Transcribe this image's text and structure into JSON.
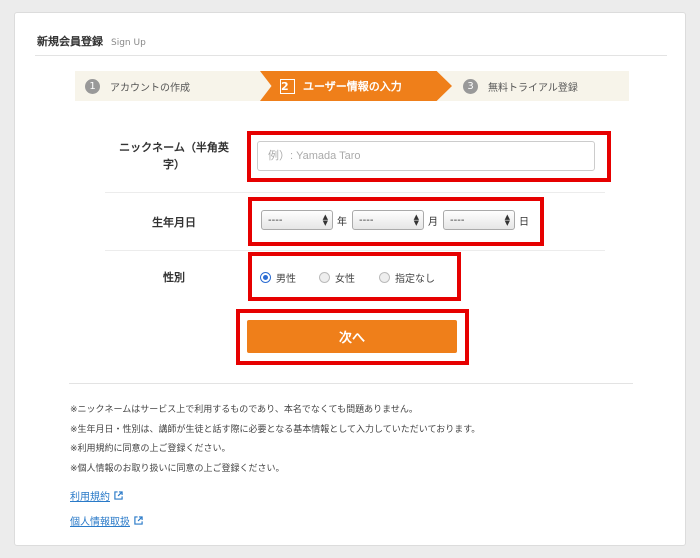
{
  "header": {
    "title": "新規会員登録",
    "subtitle": "Sign Up"
  },
  "steps": [
    {
      "num": "1",
      "label": "アカウントの作成"
    },
    {
      "num": "2",
      "label": "ユーザー情報の入力"
    },
    {
      "num": "3",
      "label": "無料トライアル登録"
    }
  ],
  "form": {
    "nickname_label_line1": "ニックネーム（半角英",
    "nickname_label_line2": "字）",
    "nickname_placeholder": "例）: Yamada Taro",
    "birth_label": "生年月日",
    "year_value": "----",
    "month_value": "----",
    "day_value": "----",
    "year_unit": "年",
    "month_unit": "月",
    "day_unit": "日",
    "gender_label": "性別",
    "gender_options": [
      "男性",
      "女性",
      "指定なし"
    ],
    "next_button": "次へ"
  },
  "notes": [
    "※ニックネームはサービス上で利用するものであり、本名でなくても問題ありません。",
    "※生年月日・性別は、講師が生徒と話す際に必要となる基本情報として入力していただいております。",
    "※利用規約に同意の上ご登録ください。",
    "※個人情報のお取り扱いに同意の上ご登録ください。"
  ],
  "links": {
    "terms": "利用規約",
    "privacy": "個人情報取扱"
  },
  "colors": {
    "accent": "#ef7f1a",
    "highlight": "#e60000",
    "link": "#2a7ac8"
  }
}
